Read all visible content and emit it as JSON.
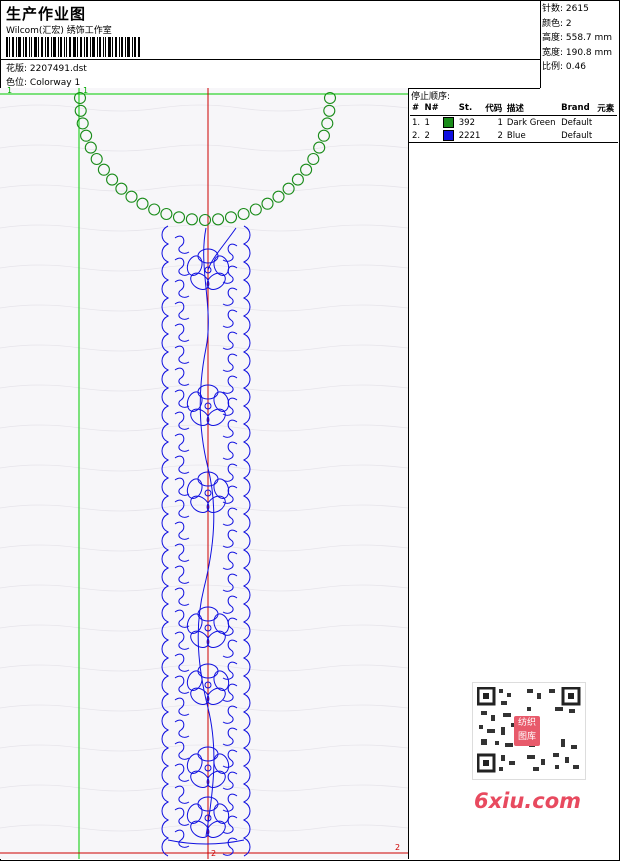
{
  "header": {
    "title": "生产作业图",
    "company": "Wilcom(汇宏) 绣饰工作室",
    "design_label": "花版:",
    "design_value": "2207491.dst",
    "colorway_label": "色位:",
    "colorway_value": "Colorway 1"
  },
  "stats": {
    "stitches": "针数: 2615",
    "colors": "颜色: 2",
    "height": "高度: 558.7 mm",
    "width": "宽度: 190.8 mm",
    "scale": "比例: 0.46"
  },
  "stop_sequence": {
    "title": "停止顺序:",
    "columns": [
      "#",
      "N#",
      "St.",
      "代码",
      "描述",
      "Brand",
      "元素"
    ],
    "rows": [
      {
        "index": "1.",
        "needle": "1",
        "color": "#1a8c1a",
        "stitches": "392",
        "code": "1",
        "desc": "Dark Green",
        "brand": "Default"
      },
      {
        "index": "2.",
        "needle": "2",
        "color": "#1010e0",
        "stitches": "2221",
        "code": "2",
        "desc": "Blue",
        "brand": "Default"
      }
    ]
  },
  "canvas": {
    "marker_top_left": "1",
    "marker_top_green": "1",
    "marker_bottom_red": "2",
    "marker_bottom_right": "2"
  },
  "colors": {
    "green": "#1a8c1a",
    "blue": "#1010e0",
    "guide_green": "#00cc00",
    "guide_red": "#cc0000"
  },
  "watermark": {
    "text": "6xiu.com",
    "logo": "纺织图库"
  }
}
